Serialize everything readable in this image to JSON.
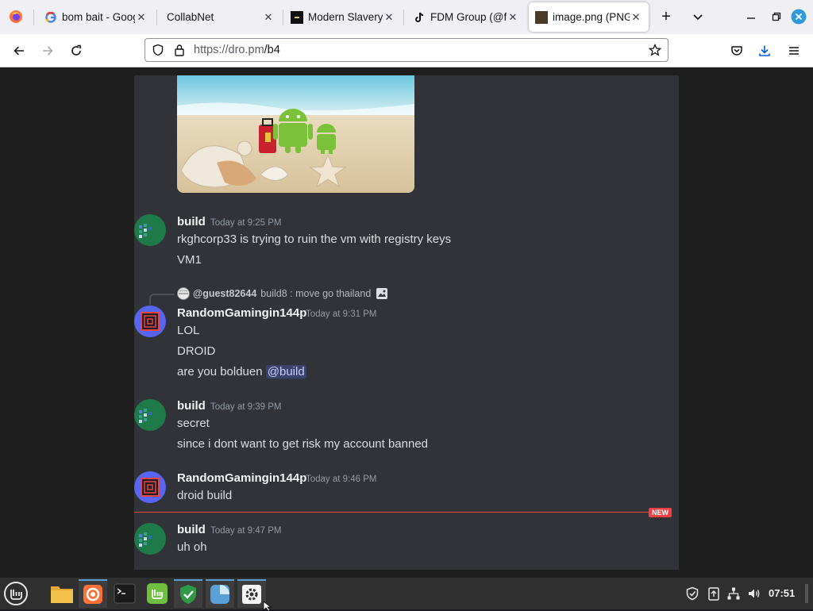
{
  "browser": {
    "tabs": [
      {
        "label": "bom bait - Google",
        "icon": "google-icon"
      },
      {
        "label": "CollabNet",
        "icon": ""
      },
      {
        "label": "Modern Slavery",
        "icon": "modern-slavery-favicon"
      },
      {
        "label": "FDM Group (@fd",
        "icon": "tiktok-icon"
      },
      {
        "label": "image.png (PNG",
        "icon": "image-favicon"
      }
    ],
    "url_host": "https://dro.pm",
    "url_path": "/b4"
  },
  "chat": {
    "messages": [
      {
        "user": "build",
        "time": "Today at 9:25 PM",
        "lines": [
          "rkghcorp33 is trying to ruin the vm with registry keys",
          "VM1"
        ]
      },
      {
        "user": "RandomGamingin144p",
        "time": "Today at 9:31 PM",
        "lines": [
          "LOL",
          "DROID",
          "are you bolduen"
        ],
        "mention": "@build",
        "reply": {
          "user": "@guest82644",
          "text": "build8 : move go thailand"
        }
      },
      {
        "user": "build",
        "time": "Today at 9:39 PM",
        "lines": [
          "secret",
          "since i dont want to get risk my account banned"
        ]
      },
      {
        "user": "RandomGamingin144p",
        "time": "Today at 9:46 PM",
        "lines": [
          "droid build"
        ]
      },
      {
        "user": "build",
        "time": "Today at 9:47 PM",
        "lines": [
          "uh oh"
        ]
      }
    ],
    "new_badge": "NEW"
  },
  "taskbar": {
    "clock": "07:51"
  },
  "colors": {
    "chat_bg": "#313338",
    "new_divider": "#f23f43",
    "mention_bg": "#3c4270",
    "accent_blue": "#0060df"
  }
}
